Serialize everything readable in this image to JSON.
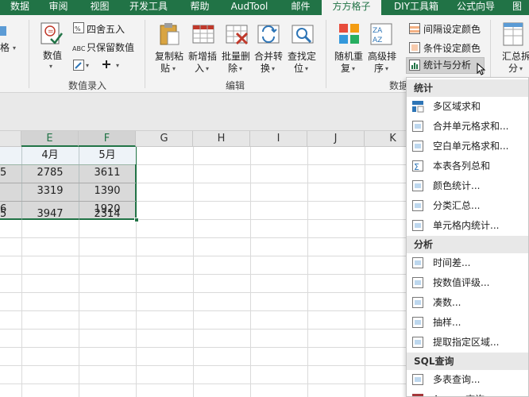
{
  "tabs": [
    "数据",
    "审阅",
    "视图",
    "开发工具",
    "帮助",
    "AudTool",
    "邮件",
    "方方格子",
    "DIY工具箱",
    "公式向导",
    "图"
  ],
  "active_tab": "方方格子",
  "ribbon": {
    "left_cut_label": "格",
    "numeric": {
      "value_label": "数值",
      "round_label": "四舍五入",
      "keep_value_label": "只保留数值",
      "group_label": "数值录入"
    },
    "edit": {
      "copy_paste": [
        "复制粘",
        "贴"
      ],
      "new_insert": [
        "新增插",
        "入"
      ],
      "batch_delete": [
        "批量删",
        "除"
      ],
      "merge_convert": [
        "合并转",
        "换"
      ],
      "find_locate": [
        "查找定",
        "位"
      ],
      "group_label": "编辑"
    },
    "data": {
      "random_shuffle": [
        "随机重",
        "复"
      ],
      "advanced_sort": [
        "高级排",
        "序"
      ],
      "interval_color": "间隔设定颜色",
      "cond_color": "条件设定颜色",
      "stats_analysis": "统计与分析",
      "group_label_cut": "数据",
      "summary_split": [
        "汇总拆",
        "分"
      ]
    }
  },
  "grid": {
    "columns": [
      {
        "name": "E",
        "selected": true
      },
      {
        "name": "F",
        "selected": true
      },
      {
        "name": "G",
        "selected": false
      },
      {
        "name": "H",
        "selected": false
      },
      {
        "name": "I",
        "selected": false
      },
      {
        "name": "J",
        "selected": false
      },
      {
        "name": "K",
        "selected": false
      }
    ],
    "rows": [
      {
        "d": "",
        "e": "4月",
        "f": "5月"
      },
      {
        "d": "5",
        "e": "2785",
        "f": "3611"
      },
      {
        "d": "",
        "e": "3319",
        "f": "1390"
      },
      {
        "d": "6",
        "e": "",
        "f": "1920"
      },
      {
        "d": "5",
        "e": "3947",
        "f": "2314"
      }
    ]
  },
  "menu": {
    "sections": [
      {
        "title": "统计",
        "items": [
          "多区域求和",
          "合并单元格求和...",
          "空白单元格求和...",
          "本表各列总和",
          "颜色统计...",
          "分类汇总...",
          "单元格内统计..."
        ]
      },
      {
        "title": "分析",
        "items": [
          "时间差...",
          "按数值评级...",
          "凑数...",
          "抽样...",
          "提取指定区域..."
        ]
      },
      {
        "title": "SQL查询",
        "items": [
          "多表查询...",
          "Access查询..."
        ]
      }
    ]
  },
  "colors": {
    "accent": "#217346",
    "selection_fill": "#d9d9d9",
    "menu_section_bg": "#e8e8e8"
  }
}
